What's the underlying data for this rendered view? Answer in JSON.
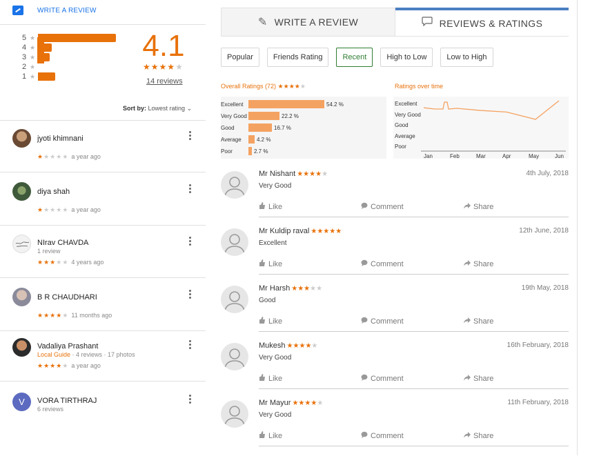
{
  "left": {
    "write_review": "WRITE A REVIEW",
    "histogram": [
      {
        "label": "5",
        "fraction": 1.0
      },
      {
        "label": "4",
        "fraction": 0.18
      },
      {
        "label": "3",
        "fraction": 0.15
      },
      {
        "label": "2",
        "fraction": 0.0
      },
      {
        "label": "1",
        "fraction": 0.22
      }
    ],
    "rating": "4.1",
    "rating_stars": 4,
    "review_count": "14 reviews",
    "sort_label": "Sort by:",
    "sort_value": "Lowest rating",
    "reviewers": [
      {
        "name": "jyoti khimnani",
        "sub": "",
        "stars": 1,
        "time": "a year ago"
      },
      {
        "name": "diya shah",
        "sub": "",
        "stars": 1,
        "time": "a year ago"
      },
      {
        "name": "NIrav CHAVDA",
        "sub": "1 review",
        "stars": 3,
        "time": "4 years ago"
      },
      {
        "name": "B R CHAUDHARI",
        "sub": "",
        "stars": 4,
        "time": "11 months ago"
      },
      {
        "name": "Vadaliya Prashant",
        "guide": "Local Guide",
        "sub": " · 4 reviews · 17 photos",
        "stars": 4,
        "time": "a year ago"
      },
      {
        "name": "VORA TIRTHRAJ",
        "sub": "6 reviews",
        "initial": "V"
      }
    ]
  },
  "right": {
    "tabs": [
      {
        "label": "WRITE A REVIEW",
        "icon": "pencil-icon"
      },
      {
        "label": "REVIEWS & RATINGS",
        "icon": "speech-bubble-icon"
      }
    ],
    "filters": [
      "Popular",
      "Friends Rating",
      "Recent",
      "High to Low",
      "Low to High"
    ],
    "selected_filter": "Recent",
    "overall": {
      "title": "Overall Ratings (72)",
      "stars": 4
    },
    "over_time": {
      "title": "Ratings over time"
    },
    "reviews": [
      {
        "name": "Mr Nishant",
        "stars": 4,
        "date": "4th July, 2018",
        "text": "Very Good"
      },
      {
        "name": "Mr Kuldip raval",
        "stars": 5,
        "date": "12th June, 2018",
        "text": "Excellent"
      },
      {
        "name": "Mr Harsh",
        "stars": 3,
        "date": "19th May, 2018",
        "text": "Good"
      },
      {
        "name": "Mukesh",
        "stars": 4,
        "date": "16th February, 2018",
        "text": "Very Good"
      },
      {
        "name": "Mr Mayur",
        "stars": 4,
        "date": "11th February, 2018",
        "text": "Very Good"
      }
    ],
    "actions": {
      "like": "Like",
      "comment": "Comment",
      "share": "Share"
    }
  },
  "chart_data": [
    {
      "type": "bar",
      "title": "Overall Ratings (72)",
      "categories": [
        "Excellent",
        "Very Good",
        "Good",
        "Average",
        "Poor"
      ],
      "values": [
        54.2,
        22.2,
        16.7,
        4.2,
        2.7
      ],
      "value_labels": [
        "54.2 %",
        "22.2 %",
        "16.7 %",
        "4.2 %",
        "2.7 %"
      ],
      "orientation": "horizontal",
      "color": "#f4a261"
    },
    {
      "type": "line",
      "title": "Ratings over time",
      "x": [
        "Jan",
        "Feb",
        "Mar",
        "Apr",
        "May",
        "Jun"
      ],
      "y_categories": [
        "Excellent",
        "Very Good",
        "Good",
        "Average",
        "Poor"
      ],
      "series": [
        {
          "values": [
            4.65,
            4.55,
            4.35,
            4.2,
            4.05,
            4.5
          ]
        }
      ],
      "color": "#f4a261"
    }
  ],
  "colors": {
    "accent": "#e8710a",
    "link": "#1a73e8",
    "tab_active": "#4a7fc1",
    "selected_filter": "#2e7d32"
  }
}
